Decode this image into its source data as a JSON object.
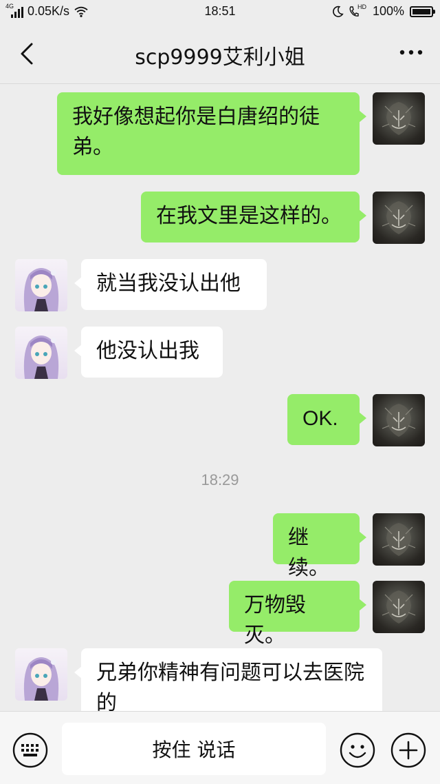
{
  "status_bar": {
    "network_type": "4G",
    "speed": "0.05K/s",
    "time": "18:51",
    "hd_label": "HD",
    "battery": "100%",
    "icons": [
      "signal-icon",
      "wifi-icon",
      "moon-icon",
      "hd-call-icon",
      "battery-icon"
    ]
  },
  "header": {
    "title": "scp9999艾利小姐",
    "back_icon": "chevron-left-icon",
    "more_icon": "more-dots-icon"
  },
  "messages": [
    {
      "sender": "self",
      "text": "我好像想起你是白唐绍的徒弟。"
    },
    {
      "sender": "self",
      "text": "在我文里是这样的。"
    },
    {
      "sender": "other",
      "text": "就当我没认出他"
    },
    {
      "sender": "other",
      "text": "他没认出我"
    },
    {
      "sender": "self",
      "text": "OK."
    },
    {
      "type": "time",
      "text": "18:29"
    },
    {
      "sender": "self",
      "text": "继续。"
    },
    {
      "sender": "self",
      "text": "万物毁灭。"
    },
    {
      "sender": "other",
      "text": "兄弟你精神有问题可以去医院的"
    }
  ],
  "input_bar": {
    "hold_to_talk_label": "按住 说话",
    "keyboard_icon": "keyboard-icon",
    "emoji_icon": "emoji-icon",
    "plus_icon": "plus-circle-icon"
  },
  "colors": {
    "background": "#ededed",
    "self_bubble": "#95ec69",
    "other_bubble": "#ffffff",
    "time_text": "#999999"
  }
}
